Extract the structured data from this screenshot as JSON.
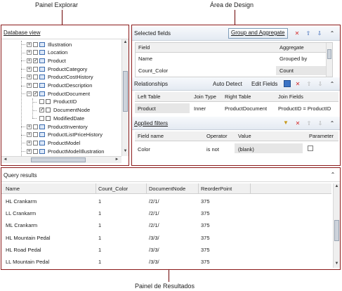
{
  "callouts": {
    "explorer": "Painel Explorar",
    "design": "Área de Design",
    "results": "Painel de Resultados"
  },
  "explorer": {
    "title": "Database view",
    "tree": [
      {
        "label": "Illustration",
        "expander": "+",
        "kind": "table",
        "checked": false
      },
      {
        "label": "Location",
        "expander": "+",
        "kind": "table",
        "checked": false
      },
      {
        "label": "Product",
        "expander": "+",
        "kind": "table",
        "checked": true
      },
      {
        "label": "ProductCategory",
        "expander": "+",
        "kind": "table",
        "checked": false
      },
      {
        "label": "ProductCostHistory",
        "expander": "+",
        "kind": "table",
        "checked": false
      },
      {
        "label": "ProductDescription",
        "expander": "+",
        "kind": "table",
        "checked": false
      },
      {
        "label": "ProductDocument",
        "expander": "−",
        "kind": "table",
        "checked": true
      },
      {
        "label": "ProductID",
        "kind": "field",
        "checked": false
      },
      {
        "label": "DocumentNode",
        "kind": "field",
        "checked": true
      },
      {
        "label": "ModifiedDate",
        "kind": "field",
        "checked": false
      },
      {
        "label": "ProductInventory",
        "expander": "+",
        "kind": "table",
        "checked": false
      },
      {
        "label": "ProductListPriceHistory",
        "expander": "+",
        "kind": "table",
        "checked": false
      },
      {
        "label": "ProductModel",
        "expander": "+",
        "kind": "table",
        "checked": false
      },
      {
        "label": "ProductModelIllustration",
        "expander": "+",
        "kind": "table",
        "checked": false
      }
    ]
  },
  "selected_fields": {
    "title": "Selected fields",
    "group_button": "Group and Aggregate",
    "headers": {
      "field": "Field",
      "aggregate": "Aggregate"
    },
    "rows": [
      {
        "field": "Name",
        "aggregate": "Grouped by"
      },
      {
        "field": "Count_Color",
        "aggregate": "Count"
      }
    ]
  },
  "relationships": {
    "title": "Relationships",
    "auto_detect": "Auto Detect",
    "edit_fields": "Edit Fields",
    "headers": {
      "left": "Left Table",
      "join": "Join Type",
      "right": "Right Table",
      "fields": "Join Fields"
    },
    "rows": [
      {
        "left": "Product",
        "join": "Inner",
        "right": "ProductDocument",
        "fields": "ProductID = ProductID"
      }
    ]
  },
  "filters": {
    "title": "Applied filters",
    "headers": {
      "field": "Field name",
      "operator": "Operator",
      "value": "Value",
      "parameter": "Parameter"
    },
    "rows": [
      {
        "field": "Color",
        "operator": "is not",
        "value": "(blank)",
        "parameter": false
      }
    ]
  },
  "results": {
    "title": "Query results",
    "headers": [
      "Name",
      "Count_Color",
      "DocumentNode",
      "ReorderPoint"
    ],
    "rows": [
      [
        "HL Crankarm",
        "1",
        "/2/1/",
        "375"
      ],
      [
        "LL Crankarm",
        "1",
        "/2/1/",
        "375"
      ],
      [
        "ML Crankarm",
        "1",
        "/2/1/",
        "375"
      ],
      [
        "HL Mountain Pedal",
        "1",
        "/3/3/",
        "375"
      ],
      [
        "HL Road Pedal",
        "1",
        "/3/3/",
        "375"
      ],
      [
        "LL Mountain Pedal",
        "1",
        "/3/3/",
        "375"
      ]
    ]
  },
  "icons": {
    "delete": "✕",
    "up": "⇧",
    "down": "⇩",
    "collapse": "⌃",
    "filter": "▼",
    "scroll_up": "▲",
    "scroll_down": "▼",
    "scroll_left": "◄",
    "scroll_right": "►",
    "check": "✓"
  },
  "colors": {
    "frame": "#8b1a1a",
    "accent_delete": "#d42a2a",
    "accent_blue": "#2f5fb3"
  }
}
